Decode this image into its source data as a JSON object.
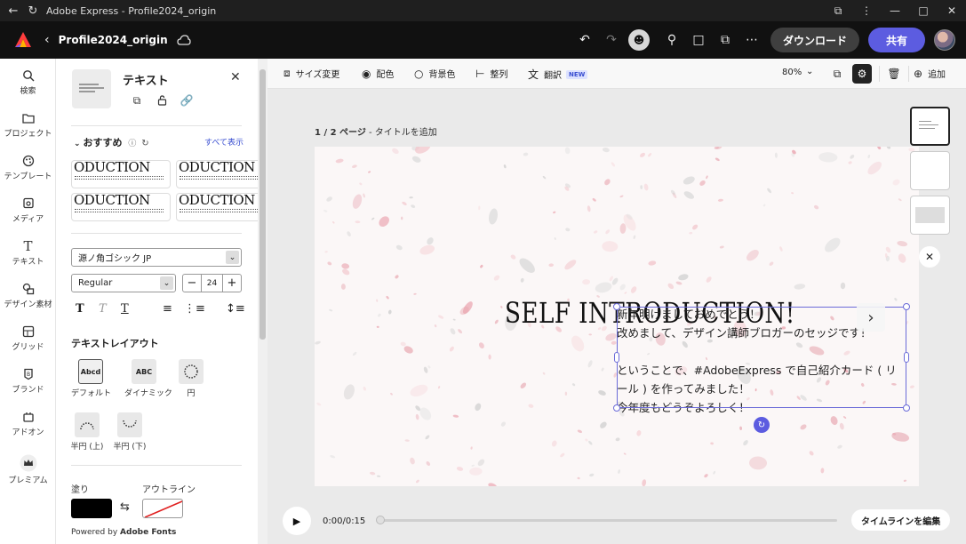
{
  "window": {
    "title": "Adobe Express - Profile2024_origin"
  },
  "header": {
    "doc_title": "Profile2024_origin",
    "download_label": "ダウンロード",
    "share_label": "共有"
  },
  "rail": {
    "items": [
      {
        "label": "検索",
        "icon": "search-icon"
      },
      {
        "label": "プロジェクト",
        "icon": "folder-icon"
      },
      {
        "label": "テンプレート",
        "icon": "template-icon"
      },
      {
        "label": "メディア",
        "icon": "media-icon"
      },
      {
        "label": "テキスト",
        "icon": "text-icon"
      },
      {
        "label": "デザイン素材",
        "icon": "shapes-icon"
      },
      {
        "label": "グリッド",
        "icon": "grid-icon"
      },
      {
        "label": "ブランド",
        "icon": "brand-icon"
      },
      {
        "label": "アドオン",
        "icon": "addon-icon"
      },
      {
        "label": "プレミアム",
        "icon": "premium-crown-icon"
      }
    ]
  },
  "panel": {
    "title": "テキスト",
    "recommend_title": "おすすめ",
    "show_all": "すべて表示",
    "rec_heading": "ODUCTION",
    "font_family": "源ノ角ゴシック JP",
    "font_weight": "Regular",
    "font_size": "24",
    "layout_title": "テキストレイアウト",
    "layouts": [
      {
        "label": "デフォルト",
        "preview": "Abcd"
      },
      {
        "label": "ダイナミック",
        "preview": "ABC"
      },
      {
        "label": "円",
        "preview": ""
      },
      {
        "label": "半円 (上)",
        "preview": ""
      },
      {
        "label": "半円 (下)",
        "preview": ""
      }
    ],
    "fill_label": "塗り",
    "outline_label": "アウトライン",
    "fill_color": "#000000",
    "powered_prefix": "Powered by",
    "powered_brand": "Adobe Fonts"
  },
  "toolbar": {
    "resize": "サイズ変更",
    "color": "配色",
    "background": "背景色",
    "align": "整列",
    "translate": "翻訳",
    "new_badge": "NEW",
    "zoom": "80%",
    "add": "追加"
  },
  "canvas": {
    "page_indicator": "1 / 2 ページ",
    "page_title_placeholder": "タイトルを追加",
    "heading": "SELF INTRODUCTION!",
    "body_lines": [
      "新年明けましておめでとう！",
      "改めまして、デザイン講師ブロガーのセッジです！",
      "",
      "ということで、#AdobeExpress で自己紹介カード ( リ",
      "ール ) を作ってみました！",
      "今年度もどうぞよろしく！"
    ]
  },
  "timeline": {
    "time": "0:00/0:15",
    "edit_label": "タイムラインを編集"
  },
  "colors": {
    "accent": "#5c5ce0",
    "link": "#3a4fd1",
    "selection": "#6b6bd8"
  }
}
